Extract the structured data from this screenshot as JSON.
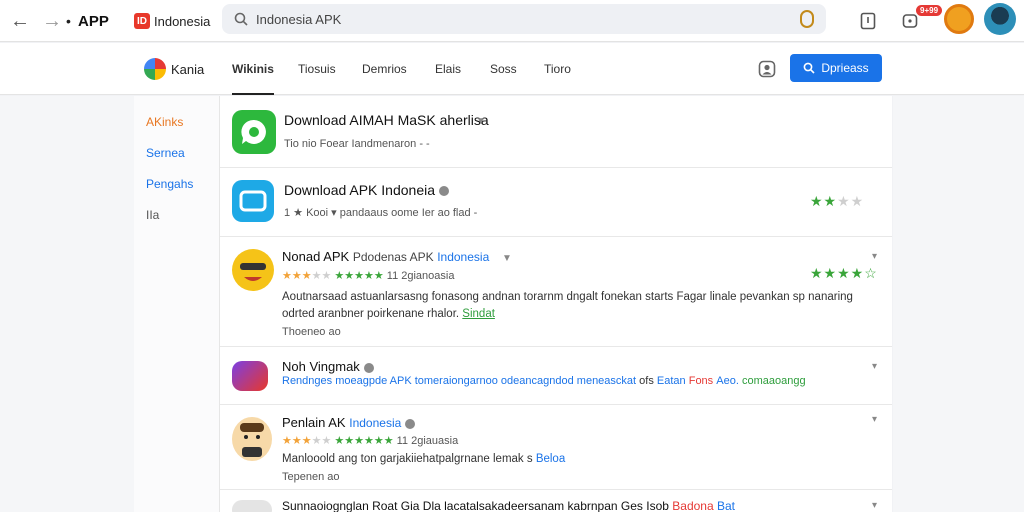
{
  "browser": {
    "app_label": "APP",
    "site_name": "Indonesia",
    "site_logo_text": "ID",
    "search_value": "Indonesia APK",
    "notification_badge": "9+99",
    "icons": [
      "back-arrow-icon",
      "forward-arrow-icon",
      "search-icon",
      "mic-icon",
      "bookmark-icon",
      "notifications-icon"
    ]
  },
  "subnav": {
    "brand": "Kania",
    "tabs": [
      {
        "label": "Wikinis",
        "active": true
      },
      {
        "label": "Tiosuis"
      },
      {
        "label": "Demrios"
      },
      {
        "label": "Elais"
      },
      {
        "label": "Soss"
      },
      {
        "label": "Tioro"
      }
    ],
    "download_button": "Dprieass"
  },
  "sidebar": {
    "items": [
      {
        "label": "AKinks",
        "color": "#e87722"
      },
      {
        "label": "Sernea",
        "color": "#1a73e8"
      },
      {
        "label": "Pengahs",
        "color": "#1a73e8"
      },
      {
        "label": "IIa",
        "color": "#555555"
      }
    ]
  },
  "list": [
    {
      "title": "Download AIMAH MaSK aherlisa",
      "sub": "Tio  nio  Foear  Iandmenaron  -  -"
    },
    {
      "title": "Download APK Indoneia",
      "sub": "1  ★  Kooi  ▾  pandaaus  oome  Ier  ao  flad  -",
      "rating": 2
    },
    {
      "title_a": "Nonad APK",
      "title_b": "Pdodenas APK",
      "title_c": "Indonesia",
      "sub_count": "11  2gianoasia",
      "desc1": "Aoutnarsaad astuanlarsasng fonasong andnan torarnm dngalt fonekan starts Fagar linale pevankan sp nanaring",
      "desc2_a": "odrted aranbner poirkenane rhalor.",
      "desc2_b": "Sindat",
      "meta": "Thoeneo ao",
      "rating": 4
    },
    {
      "title": "Noh Vingmak",
      "desc_a": "Rendnges moeagpde APK tomeraiongarnoo odeancagndod meneasckat",
      "desc_b": "ofs",
      "desc_c": "Eatan",
      "desc_d": "Fons",
      "desc_e": "Aeo.",
      "desc_f": "comaaoangg"
    },
    {
      "title_a": "Penlain AK",
      "title_b": "Indonesia",
      "sub_count": "11  2giauasia",
      "desc_a": "Manlooold ang ton garjakiiehatpalgrnane lemak s",
      "desc_b": "Beloa",
      "meta": "Tepenen ao"
    },
    {
      "title_a": "Sunnaoiognglan Roat Gia Dla lacatalsakadeersanam kabrnpan",
      "title_b": "Ges Isob",
      "title_c": "Badona",
      "title_d": "Bat"
    }
  ]
}
